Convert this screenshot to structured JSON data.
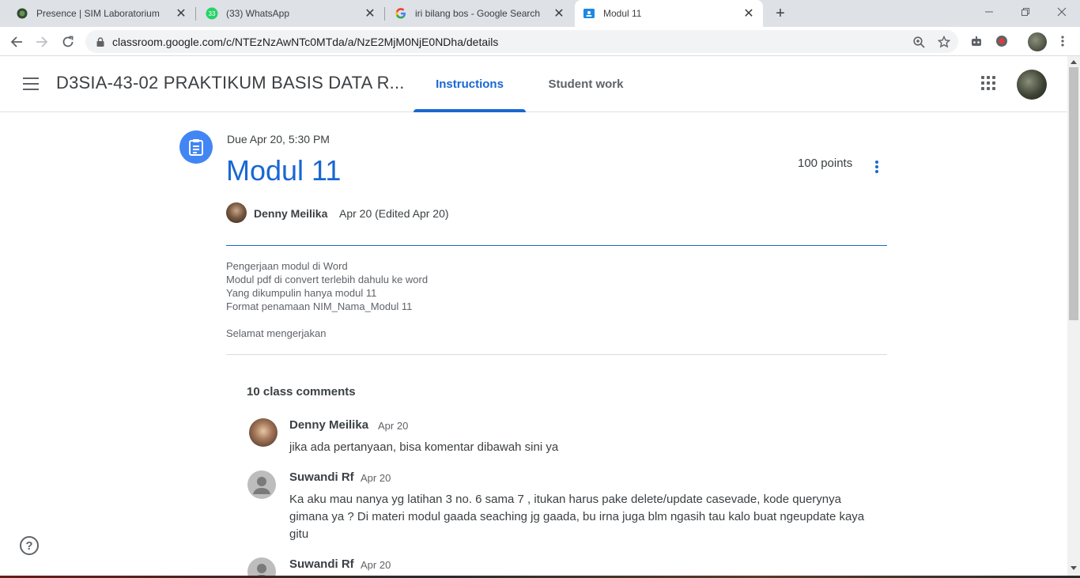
{
  "browser": {
    "tabs": [
      {
        "title": "Presence | SIM Laboratorium",
        "favicon": "sim-lab-favicon-icon"
      },
      {
        "title": "(33) WhatsApp",
        "favicon": "whatsapp-icon",
        "badge": "33"
      },
      {
        "title": "iri bilang bos - Google Search",
        "favicon": "google-icon"
      },
      {
        "title": "Modul 11",
        "favicon": "classroom-icon",
        "active": true
      }
    ],
    "url": "classroom.google.com/c/NTEzNzAwNTc0MTda/a/NzE2MjM0NjE0NDha/details"
  },
  "header": {
    "class_title": "D3SIA-43-02 PRAKTIKUM BASIS DATA R...",
    "tabs": [
      {
        "label": "Instructions",
        "active": true
      },
      {
        "label": "Student work",
        "active": false
      }
    ]
  },
  "assignment": {
    "due": "Due Apr 20, 5:30 PM",
    "title": "Modul 11",
    "points": "100 points",
    "author": "Denny Meilika",
    "posted": "Apr 20 (Edited Apr 20)",
    "description": [
      "Pengerjaan modul di Word",
      "Modul pdf di convert terlebih dahulu ke word",
      "Yang dikumpulin hanya modul 11",
      "Format penamaan NIM_Nama_Modul 11",
      "",
      "Selamat mengerjakan"
    ]
  },
  "comments": {
    "header": "10 class comments",
    "items": [
      {
        "name": "Denny Meilika",
        "date": "Apr 20",
        "text": "jika ada pertanyaan, bisa komentar dibawah sini ya"
      },
      {
        "name": "Suwandi Rf",
        "date": "Apr 20",
        "text": "Ka aku mau nanya yg latihan 3 no. 6 sama 7 , itukan harus pake delete/update casevade, kode querynya gimana ya ? Di materi modul gaada seaching jg gaada, bu irna juga blm ngasih tau kalo buat ngeupdate kaya gitu"
      },
      {
        "name": "Suwandi Rf",
        "date": "Apr 20",
        "text": ""
      }
    ]
  },
  "help": {
    "label": "?"
  },
  "colors": {
    "accent": "#1967d2",
    "assignment_icon_bg": "#4285f4"
  }
}
